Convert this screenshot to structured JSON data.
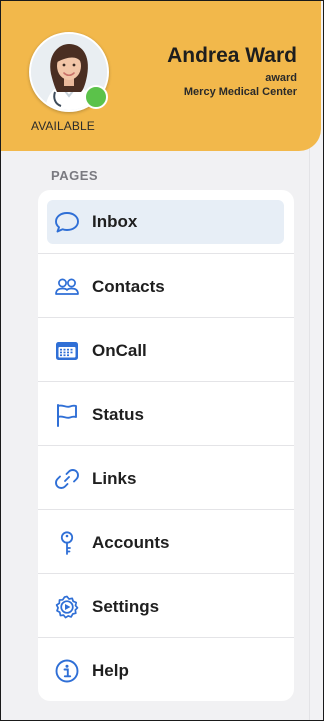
{
  "profile": {
    "name": "Andrea Ward",
    "username": "award",
    "organization": "Mercy Medical Center",
    "status": "AVAILABLE",
    "presence_color": "#5bc24a"
  },
  "header": {
    "background_color": "#f2b84b"
  },
  "pages": {
    "section_title": "PAGES",
    "accent_color": "#2f6fd6",
    "items": [
      {
        "label": "Inbox",
        "icon": "chat-bubble-icon",
        "active": true
      },
      {
        "label": "Contacts",
        "icon": "people-icon",
        "active": false
      },
      {
        "label": "OnCall",
        "icon": "calendar-icon",
        "active": false
      },
      {
        "label": "Status",
        "icon": "flag-icon",
        "active": false
      },
      {
        "label": "Links",
        "icon": "link-icon",
        "active": false
      },
      {
        "label": "Accounts",
        "icon": "key-icon",
        "active": false
      },
      {
        "label": "Settings",
        "icon": "gear-icon",
        "active": false
      },
      {
        "label": "Help",
        "icon": "info-icon",
        "active": false
      }
    ]
  }
}
